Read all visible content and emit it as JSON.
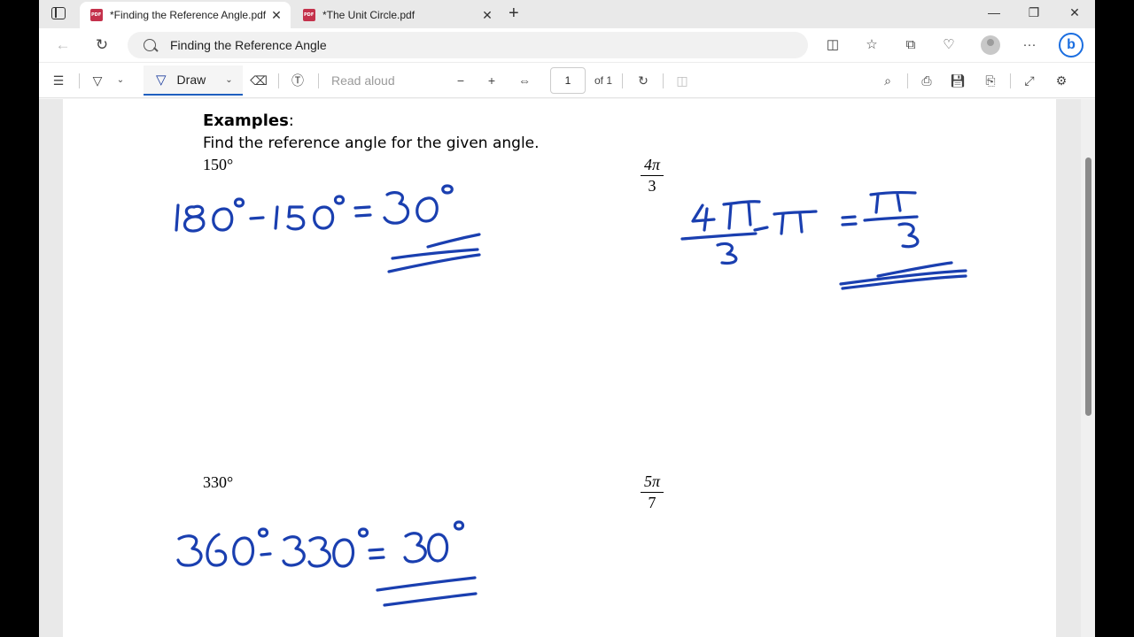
{
  "tabs": [
    {
      "label": "*Finding the Reference Angle.pdf",
      "active": true
    },
    {
      "label": "*The Unit Circle.pdf",
      "active": false
    }
  ],
  "address_bar": {
    "url_text": "Finding the Reference Angle"
  },
  "pdf_toolbar": {
    "draw_label": "Draw",
    "read_aloud_label": "Read aloud",
    "page_number": "1",
    "page_total": "of 1"
  },
  "document": {
    "heading": "Examples",
    "heading_colon": ":",
    "instruction": "Find the reference angle for the given angle.",
    "problems": [
      {
        "angle": "150°"
      },
      {
        "numerator": "4π",
        "denominator": "3"
      },
      {
        "angle": "330°"
      },
      {
        "numerator": "5π",
        "denominator": "7"
      }
    ]
  },
  "colors": {
    "ink": "#1a3fb0",
    "accent": "#1f5fbf"
  }
}
